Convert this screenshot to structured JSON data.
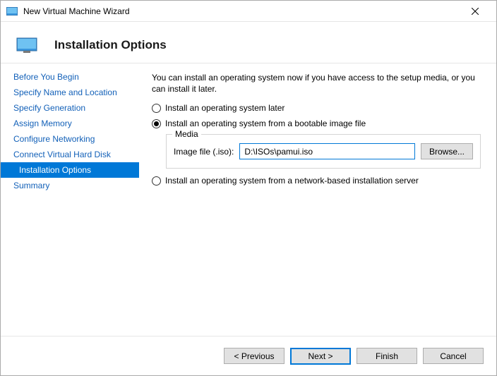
{
  "title": "New Virtual Machine Wizard",
  "header": {
    "title": "Installation Options"
  },
  "sidebar": {
    "steps": [
      "Before You Begin",
      "Specify Name and Location",
      "Specify Generation",
      "Assign Memory",
      "Configure Networking",
      "Connect Virtual Hard Disk",
      "Installation Options",
      "Summary"
    ],
    "selected_index": 6
  },
  "content": {
    "intro": "You can install an operating system now if you have access to the setup media, or you can install it later.",
    "option_later": "Install an operating system later",
    "option_image": "Install an operating system from a bootable image file",
    "option_network": "Install an operating system from a network-based installation server",
    "media_legend": "Media",
    "image_file_label": "Image file (.iso):",
    "image_file_value": "D:\\ISOs\\pamui.iso",
    "browse_label": "Browse..."
  },
  "footer": {
    "previous": "< Previous",
    "next": "Next >",
    "finish": "Finish",
    "cancel": "Cancel"
  }
}
